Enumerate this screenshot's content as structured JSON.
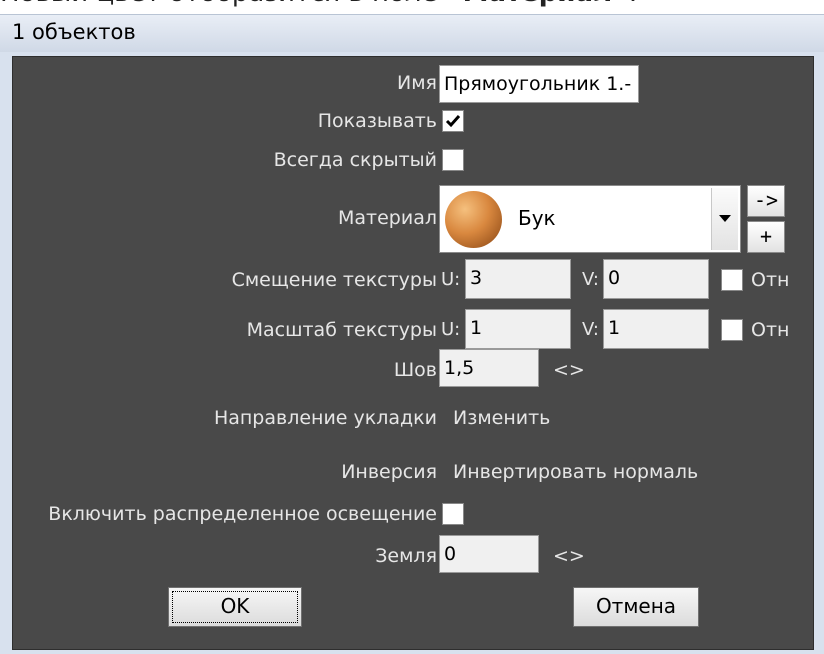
{
  "top_caption": {
    "prefix": "Новый цвет отобразится в поле ",
    "bold": "«Материал»",
    "suffix": "."
  },
  "window": {
    "title": "1 объектов"
  },
  "form": {
    "name": {
      "label": "Имя",
      "value": "Прямоугольник 1.-"
    },
    "show": {
      "label": "Показывать",
      "checked": true
    },
    "always_hidden": {
      "label": "Всегда скрытый",
      "checked": false
    },
    "material": {
      "label": "Материал",
      "value": "Бук",
      "btn_arrow": "->",
      "btn_add": "+"
    },
    "texture_offset": {
      "label": "Смещение текстуры",
      "u_label": "U:",
      "u": "3",
      "v_label": "V:",
      "v": "0",
      "rel_label": "Отн",
      "rel_checked": false
    },
    "texture_scale": {
      "label": "Масштаб текстуры",
      "u_label": "U:",
      "u": "1",
      "v_label": "V:",
      "v": "1",
      "rel_label": "Отн",
      "rel_checked": false
    },
    "seam": {
      "label": "Шов",
      "value": "1,5",
      "arrows": "<>"
    },
    "lay_direction": {
      "label": "Направление укладки",
      "action": "Изменить"
    },
    "inversion": {
      "label": "Инверсия",
      "action": "Инвертировать нормаль"
    },
    "distributed_lighting": {
      "label": "Включить распределенное освещение",
      "checked": false
    },
    "ground": {
      "label": "Земля",
      "value": "0",
      "arrows": "<>"
    }
  },
  "buttons": {
    "ok": "OK",
    "cancel": "Отмена"
  }
}
